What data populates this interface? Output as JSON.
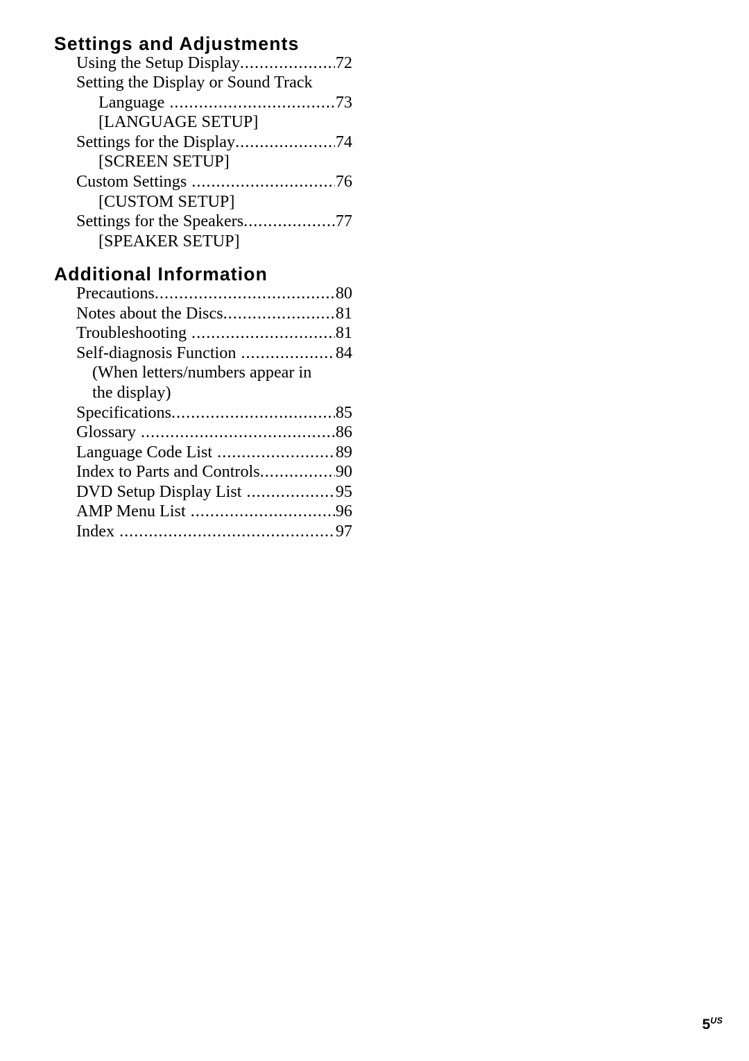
{
  "document": {
    "page_folio": "5",
    "page_region": "US"
  },
  "sections": [
    {
      "heading": "Settings and Adjustments",
      "lines": [
        {
          "kind": "entry",
          "level": 0,
          "title": "Using the Setup Display",
          "page": "72",
          "spaced": false
        },
        {
          "kind": "plain",
          "level": 0,
          "text": "Setting the Display or Sound Track"
        },
        {
          "kind": "entry",
          "level": 1,
          "title": "Language",
          "page": "73",
          "spaced": true
        },
        {
          "kind": "plain",
          "level": 1,
          "text": "[LANGUAGE SETUP]"
        },
        {
          "kind": "entry",
          "level": 0,
          "title": "Settings for the Display",
          "page": "74",
          "spaced": false
        },
        {
          "kind": "plain",
          "level": 1,
          "text": "[SCREEN SETUP]"
        },
        {
          "kind": "entry",
          "level": 0,
          "title": "Custom Settings",
          "page": "76",
          "spaced": true
        },
        {
          "kind": "plain",
          "level": 1,
          "text": "[CUSTOM SETUP]"
        },
        {
          "kind": "entry",
          "level": 0,
          "title": "Settings for the Speakers",
          "page": "77",
          "spaced": false
        },
        {
          "kind": "plain",
          "level": 1,
          "text": "[SPEAKER SETUP]"
        }
      ]
    },
    {
      "heading": "Additional Information",
      "lines": [
        {
          "kind": "entry",
          "level": 0,
          "title": "Precautions",
          "page": "80",
          "spaced": false
        },
        {
          "kind": "entry",
          "level": 0,
          "title": "Notes about the Discs",
          "page": "81",
          "spaced": false
        },
        {
          "kind": "entry",
          "level": 0,
          "title": "Troubleshooting",
          "page": "81",
          "spaced": true
        },
        {
          "kind": "entry",
          "level": 0,
          "title": "Self-diagnosis Function",
          "page": "84",
          "spaced": true
        },
        {
          "kind": "plain",
          "level": "note",
          "text": "(When letters/numbers appear in"
        },
        {
          "kind": "plain",
          "level": "note",
          "text": "the display)"
        },
        {
          "kind": "entry",
          "level": 0,
          "title": "Specifications",
          "page": "85",
          "spaced": false
        },
        {
          "kind": "entry",
          "level": 0,
          "title": "Glossary",
          "page": "86",
          "spaced": true
        },
        {
          "kind": "entry",
          "level": 0,
          "title": "Language Code List",
          "page": "89",
          "spaced": true
        },
        {
          "kind": "entry",
          "level": 0,
          "title": "Index to Parts and Controls",
          "page": "90",
          "spaced": false
        },
        {
          "kind": "entry",
          "level": 0,
          "title": "DVD Setup Display List",
          "page": "95",
          "spaced": true
        },
        {
          "kind": "entry",
          "level": 0,
          "title": "AMP Menu List",
          "page": "96",
          "spaced": true
        },
        {
          "kind": "entry",
          "level": 0,
          "title": "Index",
          "page": "97",
          "spaced": true
        }
      ]
    }
  ]
}
